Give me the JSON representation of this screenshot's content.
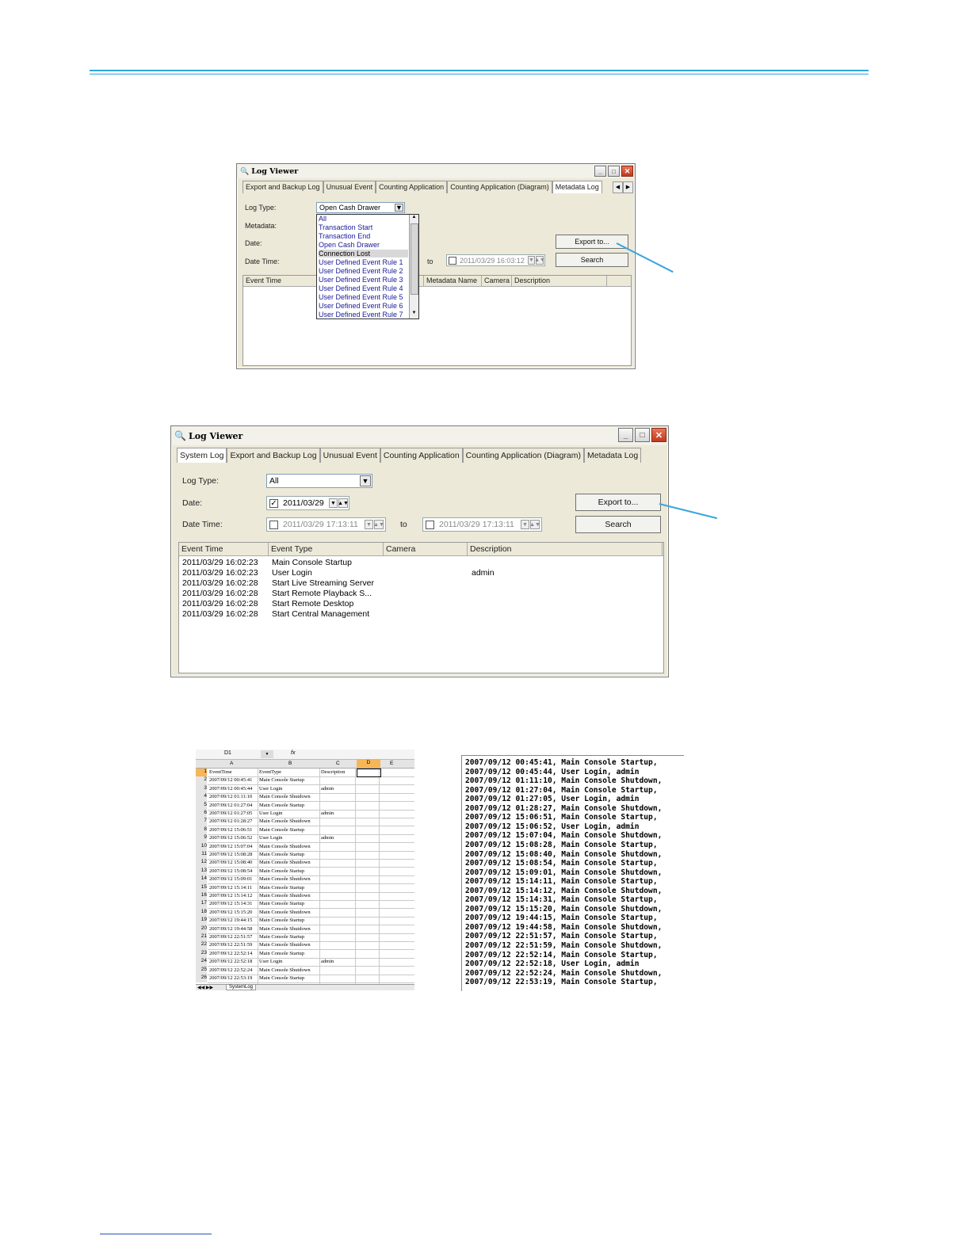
{
  "colors": {
    "accent": "#2fa5da",
    "close_button": "#c13b1c"
  },
  "window1": {
    "title": "Log Viewer",
    "tabs": [
      "Export and Backup Log",
      "Unusual Event",
      "Counting Application",
      "Counting Application (Diagram)",
      "Metadata Log"
    ],
    "labels": {
      "log_type": "Log Type:",
      "metadata": "Metadata:",
      "date": "Date:",
      "date_time": "Date Time:",
      "to": "to"
    },
    "log_type_value": "Open Cash Drawer",
    "date_time_to": "2011/03/29 16:03:12",
    "export_label": "Export to...",
    "search_label": "Search",
    "columns": [
      "Event Time",
      "Metadata Name",
      "Camera",
      "Description"
    ],
    "dropdown_items": [
      "All",
      "Transaction Start",
      "Transaction End",
      "Open Cash Drawer",
      "Connection Lost",
      "User Defined Event Rule 1",
      "User Defined Event Rule 2",
      "User Defined Event Rule 3",
      "User Defined Event Rule 4",
      "User Defined Event Rule 5",
      "User Defined Event Rule 6",
      "User Defined Event Rule 7"
    ]
  },
  "window2": {
    "title": "Log Viewer",
    "tabs": [
      "System Log",
      "Export and Backup Log",
      "Unusual Event",
      "Counting Application",
      "Counting Application (Diagram)",
      "Metadata Log"
    ],
    "labels": {
      "log_type": "Log Type:",
      "date": "Date:",
      "date_time": "Date Time:",
      "to": "to"
    },
    "log_type_value": "All",
    "date_value": "2011/03/29",
    "date_time_from": "2011/03/29 17:13:11",
    "date_time_to": "2011/03/29 17:13:11",
    "export_label": "Export to...",
    "search_label": "Search",
    "columns": [
      "Event Time",
      "Event Type",
      "Camera",
      "Description"
    ],
    "rows": [
      {
        "time": "2011/03/29 16:02:23",
        "type": "Main Console Startup",
        "camera": "",
        "desc": ""
      },
      {
        "time": "2011/03/29 16:02:23",
        "type": "User Login",
        "camera": "",
        "desc": "admin"
      },
      {
        "time": "2011/03/29 16:02:28",
        "type": "Start Live Streaming Server",
        "camera": "",
        "desc": ""
      },
      {
        "time": "2011/03/29 16:02:28",
        "type": "Start Remote Playback S...",
        "camera": "",
        "desc": ""
      },
      {
        "time": "2011/03/29 16:02:28",
        "type": "Start Remote Desktop",
        "camera": "",
        "desc": ""
      },
      {
        "time": "2011/03/29 16:02:28",
        "type": "Start Central Management",
        "camera": "",
        "desc": ""
      }
    ]
  },
  "spreadsheet": {
    "name_box": "D1",
    "fx": "fx",
    "columns": [
      "A",
      "B",
      "C",
      "D",
      "E"
    ],
    "header": [
      "EventTime",
      "EventType",
      "Description"
    ],
    "rows": [
      [
        "2007/09/12 00:45:41",
        "Main Console Startup",
        ""
      ],
      [
        "2007/09/12 00:45:44",
        "User Login",
        "admin"
      ],
      [
        "2007/09/12 01:11:10",
        "Main Console Shutdown",
        ""
      ],
      [
        "2007/09/12 01:27:04",
        "Main Console Startup",
        ""
      ],
      [
        "2007/09/12 01:27:05",
        "User Login",
        "admin"
      ],
      [
        "2007/09/12 01:28:27",
        "Main Console Shutdown",
        ""
      ],
      [
        "2007/09/12 15:06:51",
        "Main Console Startup",
        ""
      ],
      [
        "2007/09/12 15:06:52",
        "User Login",
        "admin"
      ],
      [
        "2007/09/12 15:07:04",
        "Main Console Shutdown",
        ""
      ],
      [
        "2007/09/12 15:08:28",
        "Main Console Startup",
        ""
      ],
      [
        "2007/09/12 15:08:40",
        "Main Console Shutdown",
        ""
      ],
      [
        "2007/09/12 15:08:54",
        "Main Console Startup",
        ""
      ],
      [
        "2007/09/12 15:09:01",
        "Main Console Shutdown",
        ""
      ],
      [
        "2007/09/12 15:14:11",
        "Main Console Startup",
        ""
      ],
      [
        "2007/09/12 15:14:12",
        "Main Console Shutdown",
        ""
      ],
      [
        "2007/09/12 15:14:31",
        "Main Console Startup",
        ""
      ],
      [
        "2007/09/12 15:15:20",
        "Main Console Shutdown",
        ""
      ],
      [
        "2007/09/12 19:44:15",
        "Main Console Startup",
        ""
      ],
      [
        "2007/09/12 19:44:58",
        "Main Console Shutdown",
        ""
      ],
      [
        "2007/09/12 22:51:57",
        "Main Console Startup",
        ""
      ],
      [
        "2007/09/12 22:51:59",
        "Main Console Shutdown",
        ""
      ],
      [
        "2007/09/12 22:52:14",
        "Main Console Startup",
        ""
      ],
      [
        "2007/09/12 22:52:18",
        "User Login",
        "admin"
      ],
      [
        "2007/09/12 22:52:24",
        "Main Console Shutdown",
        ""
      ],
      [
        "2007/09/12 22:53:19",
        "Main Console Startup",
        ""
      ]
    ],
    "sheet_tab": "SystemLog"
  },
  "textlog": {
    "lines": [
      "2007/09/12 00:45:41, Main Console Startup,",
      "2007/09/12 00:45:44, User Login, admin",
      "2007/09/12 01:11:10, Main Console Shutdown,",
      "2007/09/12 01:27:04, Main Console Startup,",
      "2007/09/12 01:27:05, User Login, admin",
      "2007/09/12 01:28:27, Main Console Shutdown,",
      "2007/09/12 15:06:51, Main Console Startup,",
      "2007/09/12 15:06:52, User Login, admin",
      "2007/09/12 15:07:04, Main Console Shutdown,",
      "2007/09/12 15:08:28, Main Console Startup,",
      "2007/09/12 15:08:40, Main Console Shutdown,",
      "2007/09/12 15:08:54, Main Console Startup,",
      "2007/09/12 15:09:01, Main Console Shutdown,",
      "2007/09/12 15:14:11, Main Console Startup,",
      "2007/09/12 15:14:12, Main Console Shutdown,",
      "2007/09/12 15:14:31, Main Console Startup,",
      "2007/09/12 15:15:20, Main Console Shutdown,",
      "2007/09/12 19:44:15, Main Console Startup,",
      "2007/09/12 19:44:58, Main Console Shutdown,",
      "2007/09/12 22:51:57, Main Console Startup,",
      "2007/09/12 22:51:59, Main Console Shutdown,",
      "2007/09/12 22:52:14, Main Console Startup,",
      "2007/09/12 22:52:18, User Login, admin",
      "2007/09/12 22:52:24, Main Console Shutdown,",
      "2007/09/12 22:53:19, Main Console Startup,"
    ]
  }
}
